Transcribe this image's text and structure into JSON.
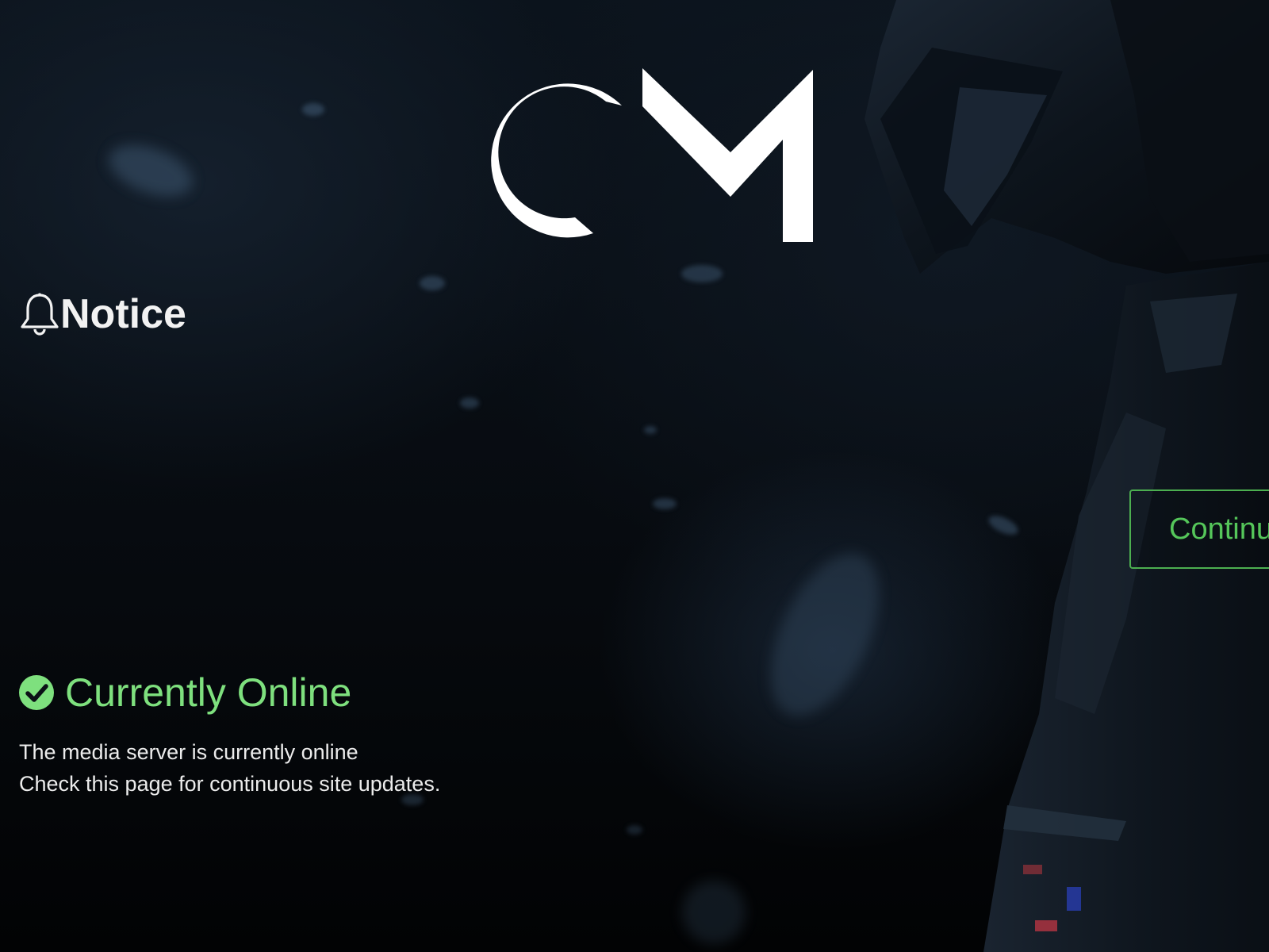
{
  "logo": {
    "text": "CM",
    "icon": "cm-logo-icon",
    "color": "#ffffff"
  },
  "notice": {
    "icon": "bell-icon",
    "title": "Notice"
  },
  "continue_button": {
    "label": "Continue"
  },
  "status": {
    "icon": "check-circle-icon",
    "title": "Currently Online",
    "line1": "The media server is currently online",
    "line2": "Check this page for continuous site updates.",
    "color": "#7ee07e"
  },
  "colors": {
    "accent": "#4caf50",
    "background": "#05080c",
    "text": "#ececec"
  }
}
